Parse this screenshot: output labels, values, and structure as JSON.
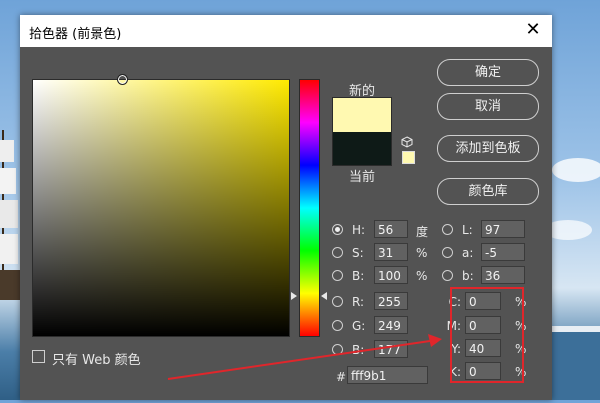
{
  "dialog": {
    "title": "拾色器 (前景色)",
    "close_glyph": "✕"
  },
  "swatches": {
    "new_label": "新的",
    "current_label": "当前",
    "new_color": "#fff9b1",
    "current_color": "#0e1a17"
  },
  "buttons": {
    "ok": "确定",
    "cancel": "取消",
    "add_to_swatches": "添加到色板",
    "color_libraries": "颜色库"
  },
  "hsb": [
    {
      "label": "H:",
      "value": "56",
      "unit": "度",
      "selected": true
    },
    {
      "label": "S:",
      "value": "31",
      "unit": "%",
      "selected": false
    },
    {
      "label": "B:",
      "value": "100",
      "unit": "%",
      "selected": false
    }
  ],
  "rgb": [
    {
      "label": "R:",
      "value": "255"
    },
    {
      "label": "G:",
      "value": "249"
    },
    {
      "label": "B:",
      "value": "177"
    }
  ],
  "lab": [
    {
      "label": "L:",
      "value": "97"
    },
    {
      "label": "a:",
      "value": "-5"
    },
    {
      "label": "b:",
      "value": "36"
    }
  ],
  "cmyk": [
    {
      "label": "C:",
      "value": "0",
      "unit": "%"
    },
    {
      "label": "M:",
      "value": "0",
      "unit": "%"
    },
    {
      "label": "Y:",
      "value": "40",
      "unit": "%"
    },
    {
      "label": "K:",
      "value": "0",
      "unit": "%"
    }
  ],
  "hex": {
    "label": "#",
    "value": "fff9b1"
  },
  "web_only": {
    "label": "只有 Web 颜色",
    "checked": false
  },
  "hue_color": "#ffea00",
  "annotation_color": "#e0262b",
  "icons": {
    "gamut_warning": "cube-icon",
    "web_safe": "web-safe-swatch-icon"
  }
}
